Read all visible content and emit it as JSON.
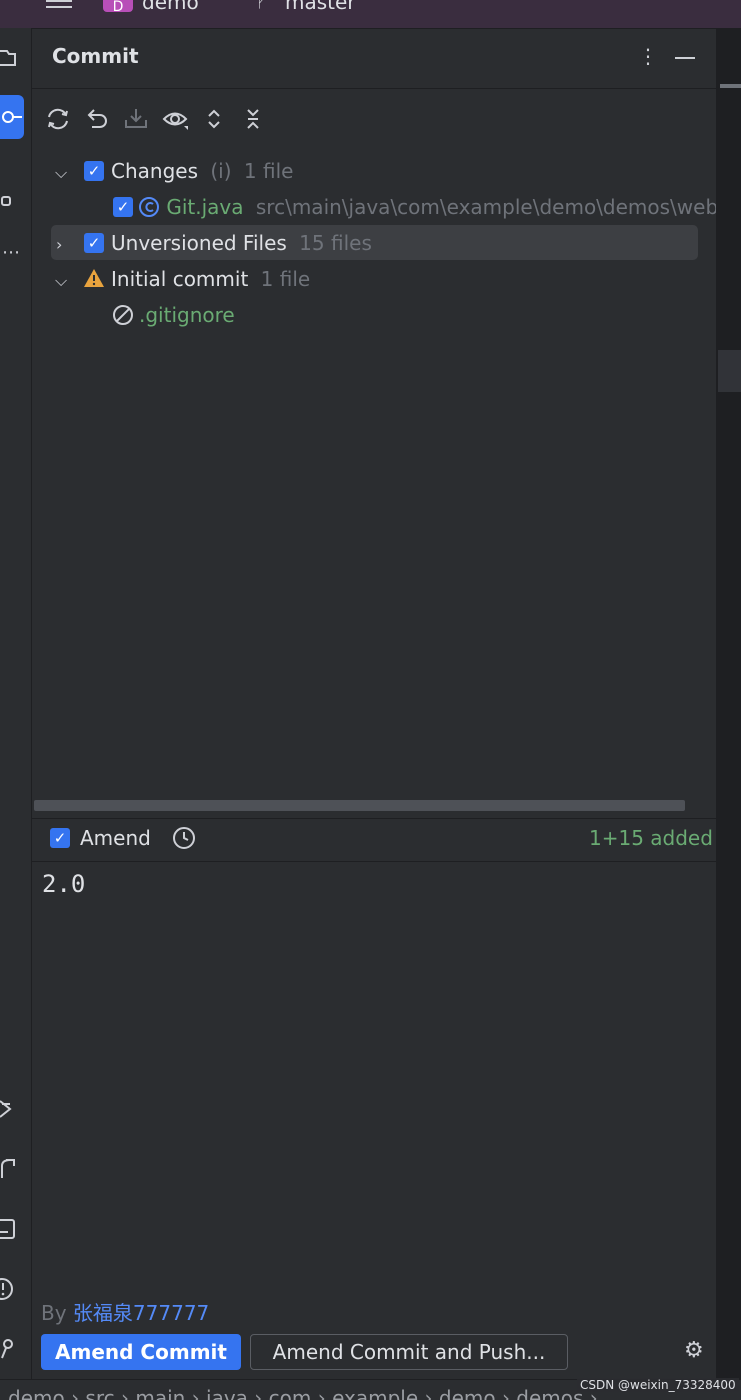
{
  "topbar": {
    "project_badge": "D",
    "project_name": "demo",
    "branch_name": "master"
  },
  "panel": {
    "title": "Commit"
  },
  "tree": {
    "changes": {
      "label": "Changes",
      "hint": "(i)",
      "count": "1 file"
    },
    "file": {
      "name": "Git.java",
      "path": "src\\main\\java\\com\\example\\demo\\demos\\web"
    },
    "unversioned": {
      "label": "Unversioned Files",
      "count": "15 files"
    },
    "initial": {
      "label": "Initial commit",
      "count": "1 file"
    },
    "ignored_file": {
      "name": ".gitignore"
    }
  },
  "amend": {
    "label": "Amend",
    "stats": "1+15 added",
    "checked": true
  },
  "message": {
    "text": "2.0"
  },
  "author": {
    "prefix": "By",
    "name": "张福泉777777"
  },
  "buttons": {
    "amend_commit": "Amend Commit",
    "amend_push": "Amend Commit and Push..."
  },
  "breadcrumb": {
    "text": "demo › src › main › java › com › example › demo › demos ›"
  },
  "watermark": "CSDN @weixin_73328400",
  "colors": {
    "accent": "#3574f0",
    "panel_bg": "#2b2d30",
    "added_green": "#6aab73",
    "warning": "#e8a33e"
  },
  "icons": [
    "menu-icon",
    "refresh-icon",
    "rollback-icon",
    "shelve-icon",
    "eye-icon",
    "expand-all-icon",
    "collapse-all-icon",
    "more-icon",
    "minimize-icon",
    "history-icon",
    "gear-icon",
    "warning-icon",
    "ignored-icon",
    "class-icon"
  ]
}
